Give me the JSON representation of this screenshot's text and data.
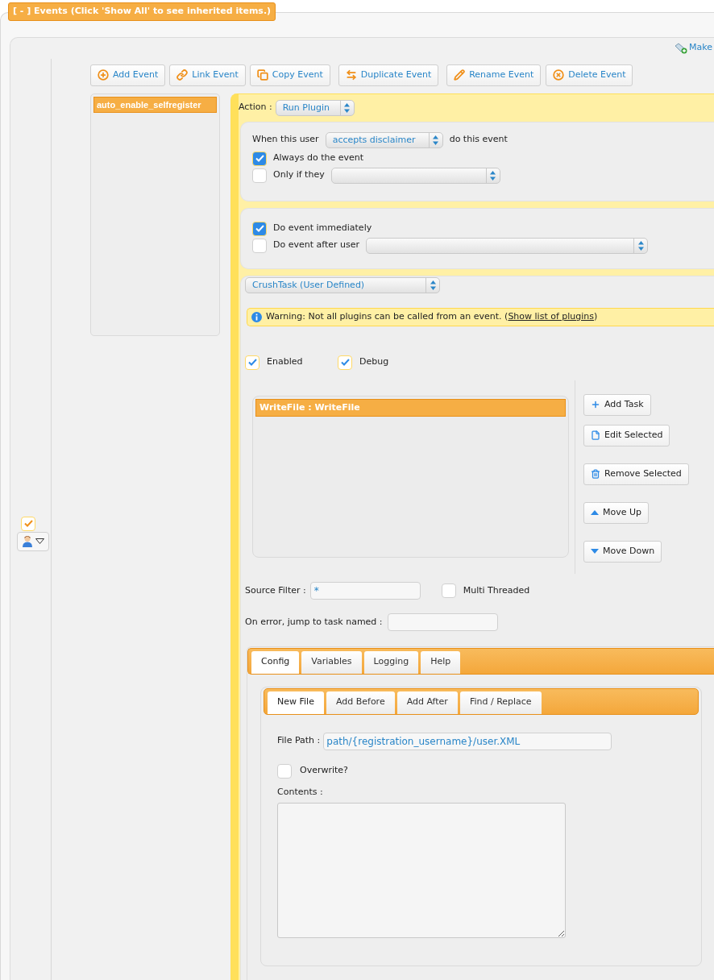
{
  "legend": "[ - ] Events (Click 'Show All' to see inherited items.)",
  "make_link": "Make",
  "toolbar": [
    "Add Event",
    "Link Event",
    "Copy Event",
    "Duplicate Event",
    "Rename Event",
    "Delete Event"
  ],
  "events": [
    {
      "name": "auto_enable_selfregister",
      "selected": true
    }
  ],
  "user_column": {
    "enabled": true
  },
  "action": {
    "label": "Action :",
    "value": "Run Plugin"
  },
  "trigger": {
    "prefix": "When this user",
    "value": "accepts disclaimer",
    "suffix": "do this event",
    "options": [
      {
        "label": "Always do the event",
        "checked": true,
        "kind": "plain"
      },
      {
        "label": "Only if they",
        "checked": false,
        "kind": "with_select"
      }
    ]
  },
  "timing": [
    {
      "label": "Do event immediately",
      "checked": true,
      "kind": "plain"
    },
    {
      "label": "Do event after user",
      "checked": false,
      "kind": "with_select"
    }
  ],
  "plugin": {
    "value": "CrushTask (User Defined)",
    "warning": "Warning: Not all plugins can be called from an event. (",
    "warning_link": "Show list of plugins",
    "warning_end": ")"
  },
  "flags": [
    {
      "label": "Enabled",
      "checked": true
    },
    {
      "label": "Debug",
      "checked": true
    }
  ],
  "tasks": [
    {
      "name": "WriteFile : WriteFile",
      "selected": true
    }
  ],
  "task_buttons": [
    "Add Task",
    "Edit Selected",
    "Remove Selected",
    "Move Up",
    "Move Down"
  ],
  "source_filter": {
    "label": "Source Filter :",
    "value": "*"
  },
  "multi_threaded": {
    "label": "Multi Threaded",
    "checked": false
  },
  "on_error": {
    "label": "On error, jump to task named :"
  },
  "tabs": [
    {
      "label": "Config",
      "selected": true
    },
    {
      "label": "Variables",
      "selected": false
    },
    {
      "label": "Logging",
      "selected": false
    },
    {
      "label": "Help",
      "selected": false
    }
  ],
  "subtabs": [
    {
      "label": "New File",
      "selected": true
    },
    {
      "label": "Add Before",
      "selected": false
    },
    {
      "label": "Add After",
      "selected": false
    },
    {
      "label": "Find / Replace",
      "selected": false
    }
  ],
  "file_path": {
    "label": "File Path :",
    "value": "path/{registration_username}/user.XML"
  },
  "overwrite": {
    "label": "Overwrite?",
    "checked": false
  },
  "contents": {
    "label": "Contents :"
  }
}
